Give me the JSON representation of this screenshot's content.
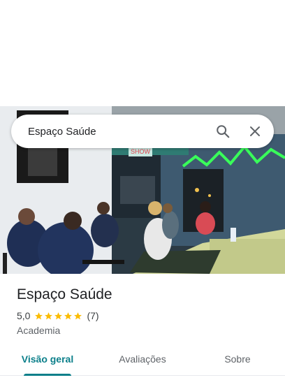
{
  "search": {
    "query": "Espaço Saúde"
  },
  "icons": {
    "search": "search-icon",
    "close": "close-icon",
    "star": "star-icon"
  },
  "place": {
    "name": "Espaço Saúde",
    "rating": "5,0",
    "stars": 5,
    "review_count": "(7)",
    "category": "Academia"
  },
  "photo": {
    "sign_text": "SHOW"
  },
  "tabs": [
    {
      "label": "Visão geral",
      "active": true
    },
    {
      "label": "Avaliações",
      "active": false
    },
    {
      "label": "Sobre",
      "active": false
    }
  ],
  "colors": {
    "accent": "#0b7f8a",
    "star": "#fbbc04",
    "text": "#202124",
    "secondary": "#5f6368"
  }
}
